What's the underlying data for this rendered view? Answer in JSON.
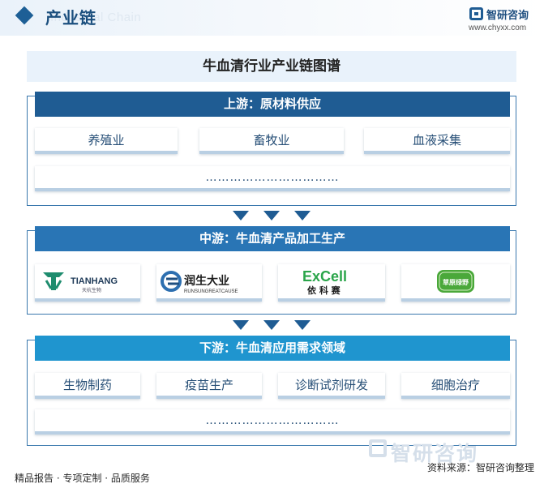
{
  "header": {
    "title": "产业链",
    "subtitle": "Industrial Chain",
    "brand_name": "智研咨询",
    "brand_url": "www.chyxx.com"
  },
  "diagram": {
    "title": "牛血清行业产业链图谱",
    "upstream": {
      "title": "上游：原材料供应",
      "items": [
        "养殖业",
        "畜牧业",
        "血液采集"
      ],
      "more": "……………………………"
    },
    "midstream": {
      "title": "中游：牛血清产品加工生产",
      "companies": [
        {
          "name": "TIANHANG",
          "sub": "天杭生物"
        },
        {
          "name": "润生大业",
          "sub": "RUNSUNGREATCAUSE"
        },
        {
          "name": "ExCell",
          "sub": "依 科 赛"
        },
        {
          "name": "草原绿野"
        }
      ]
    },
    "downstream": {
      "title": "下游：牛血清应用需求领域",
      "items": [
        "生物制药",
        "疫苗生产",
        "诊断试剂研发",
        "细胞治疗"
      ],
      "more": "……………………………"
    }
  },
  "footer": {
    "slogan": "精品报告 · 专项定制 · 品质服务",
    "source": "资料来源：智研咨询整理",
    "watermark": "智研咨询"
  },
  "colors": {
    "upstream": "#1f5c93",
    "midstream": "#2975b5",
    "downstream": "#1f95cf",
    "title_bg": "#e9f2fb",
    "excell_green": "#2aa54a",
    "tianhang_teal": "#1e8c6e"
  }
}
